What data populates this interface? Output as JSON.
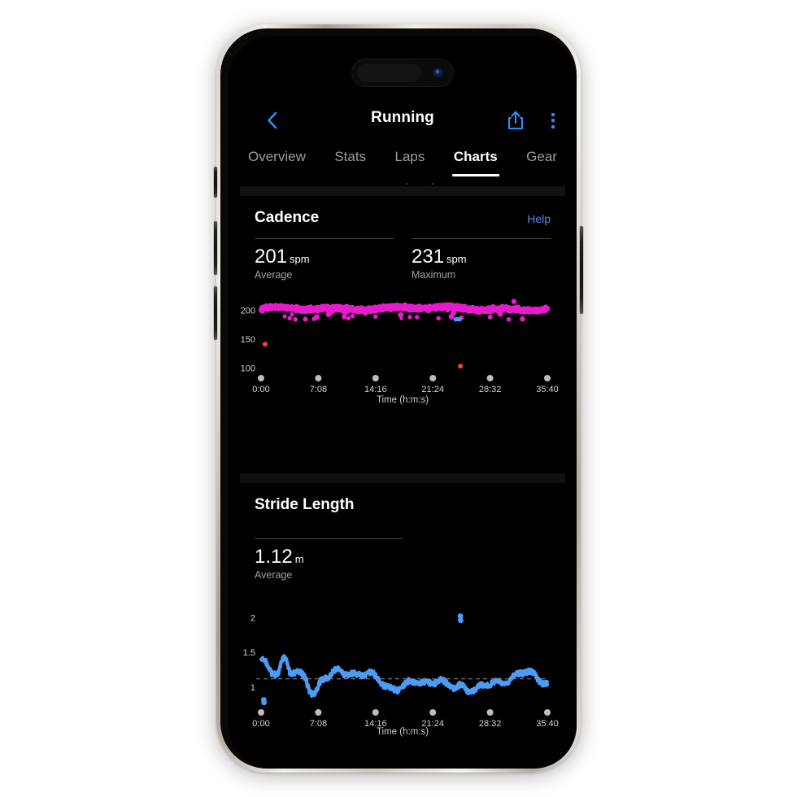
{
  "device": {
    "type": "smartphone",
    "island": {
      "camera": "front-camera"
    }
  },
  "nav": {
    "back_icon": "chevron-left-icon",
    "title": "Running",
    "share_icon": "share-icon",
    "more_icon": "more-vertical-icon",
    "accent": "#2f8cf6"
  },
  "tabs": [
    {
      "label": "Overview",
      "active": false
    },
    {
      "label": "Stats",
      "active": false
    },
    {
      "label": "Laps",
      "active": false
    },
    {
      "label": "Charts",
      "active": true
    },
    {
      "label": "Gear",
      "active": false
    }
  ],
  "sections": [
    {
      "id": "cadence",
      "title": "Cadence",
      "help_label": "Help",
      "stats": [
        {
          "value": "201",
          "unit": "spm",
          "label": "Average"
        },
        {
          "value": "231",
          "unit": "spm",
          "label": "Maximum"
        }
      ]
    },
    {
      "id": "stride-length",
      "title": "Stride Length",
      "help_label": "",
      "stats": [
        {
          "value": "1.12",
          "unit": "m",
          "label": "Average"
        }
      ]
    }
  ],
  "chart_data": [
    {
      "type": "scatter",
      "id": "cadence-chart",
      "title": "Cadence",
      "xlabel": "Time (h:m:s)",
      "ylabel": "",
      "unit": "spm",
      "xtick_labels": [
        "0:00",
        "7:08",
        "14:16",
        "21:24",
        "28:32",
        "35:40"
      ],
      "xtick_seconds": [
        0,
        428,
        856,
        1284,
        1712,
        2140
      ],
      "ytick_labels": [
        "200",
        "150",
        "100"
      ],
      "ytick_values": [
        200,
        150,
        100
      ],
      "ylim": [
        85,
        240
      ],
      "xlim": [
        0,
        2140
      ],
      "grid": false,
      "legend": false,
      "series": [
        {
          "name": "Cadence",
          "color": "#e61ccc",
          "description": "dense band of points around 196-207 spm spanning the whole run",
          "band_center": 201,
          "band_spread": 6,
          "max": 231,
          "min": 140
        },
        {
          "name": "Outlier low (red)",
          "color": "#f04436",
          "points": [
            [
              30,
              141
            ],
            [
              1490,
              103
            ]
          ]
        },
        {
          "name": "Outlier (blue)",
          "color": "#3fa0f2",
          "points": [
            [
              1470,
              184
            ]
          ]
        },
        {
          "name": "Outlier high (magenta)",
          "color": "#e61ccc",
          "points": [
            [
              1890,
              215
            ]
          ]
        }
      ]
    },
    {
      "type": "line",
      "id": "stride-length-chart",
      "title": "Stride Length",
      "xlabel": "Time (h:m:s)",
      "ylabel": "",
      "unit": "m",
      "xtick_labels": [
        "0:00",
        "7:08",
        "14:16",
        "21:24",
        "28:32",
        "35:40"
      ],
      "xtick_seconds": [
        0,
        428,
        856,
        1284,
        1712,
        2140
      ],
      "ytick_labels": [
        "2",
        "1.5",
        "1"
      ],
      "ytick_values": [
        2,
        1.5,
        1
      ],
      "ylim": [
        0.72,
        2.12
      ],
      "xlim": [
        0,
        2140
      ],
      "grid": false,
      "legend": false,
      "average_line": 1.12,
      "average_line_style": "dashed",
      "series": [
        {
          "name": "Stride Length",
          "color": "#4a9cf6",
          "description": "noisy trace oscillating roughly between 0.95 m and 1.45 m, averaging 1.12 m",
          "mean": 1.12,
          "min": 0.95,
          "max": 1.47
        },
        {
          "name": "Outlier high (blue)",
          "color": "#4a9cf6",
          "points": [
            [
              1490,
              2.02
            ],
            [
              1492,
              1.96
            ]
          ]
        },
        {
          "name": "Outlier low (blue)",
          "color": "#4a9cf6",
          "points": [
            [
              20,
              0.82
            ],
            [
              22,
              0.78
            ]
          ]
        }
      ]
    }
  ]
}
